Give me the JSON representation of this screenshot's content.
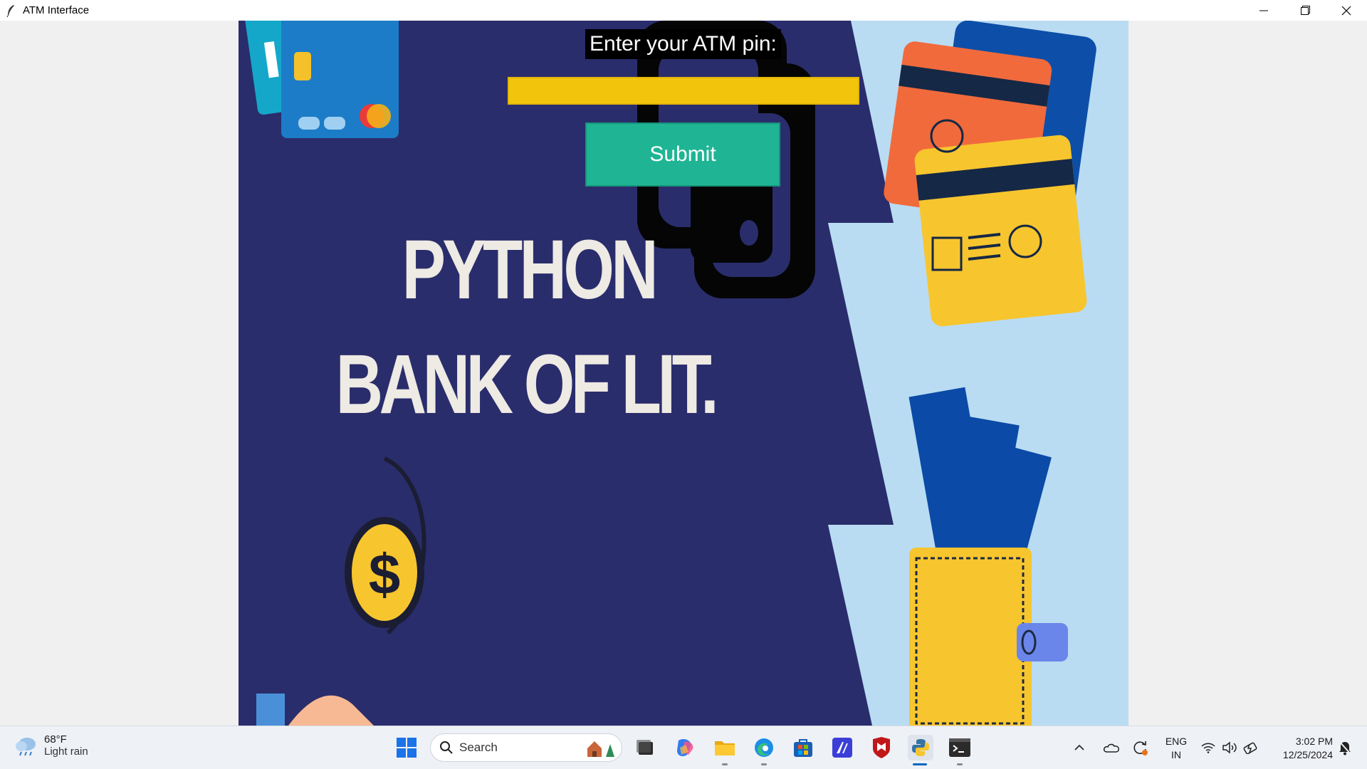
{
  "window": {
    "title": "ATM Interface",
    "controls": [
      "minimize",
      "maximize",
      "close"
    ]
  },
  "atm": {
    "pin_label": "Enter your ATM pin:",
    "pin_value": "",
    "submit_label": "Submit",
    "brand_line1": "PYTHON",
    "brand_line2": "BANK OF LIT."
  },
  "taskbar": {
    "weather": {
      "temperature": "68°F",
      "condition": "Light rain",
      "icon": "rain-cloud-icon"
    },
    "search_placeholder": "Search",
    "pinned": [
      "windows-start-icon",
      "task-view-icon",
      "copilot-icon",
      "file-explorer-icon",
      "edge-icon",
      "microsoft-store-icon",
      "vscode-icon",
      "mcafee-icon",
      "python-icon",
      "terminal-icon"
    ],
    "tray": {
      "language_line1": "ENG",
      "language_line2": "IN",
      "time": "3:02 PM",
      "date": "12/25/2024"
    }
  },
  "colors": {
    "navy": "#2a2d6b",
    "light_blue": "#b9dcf3",
    "pin_field": "#f2c40c",
    "submit": "#1fb594"
  }
}
